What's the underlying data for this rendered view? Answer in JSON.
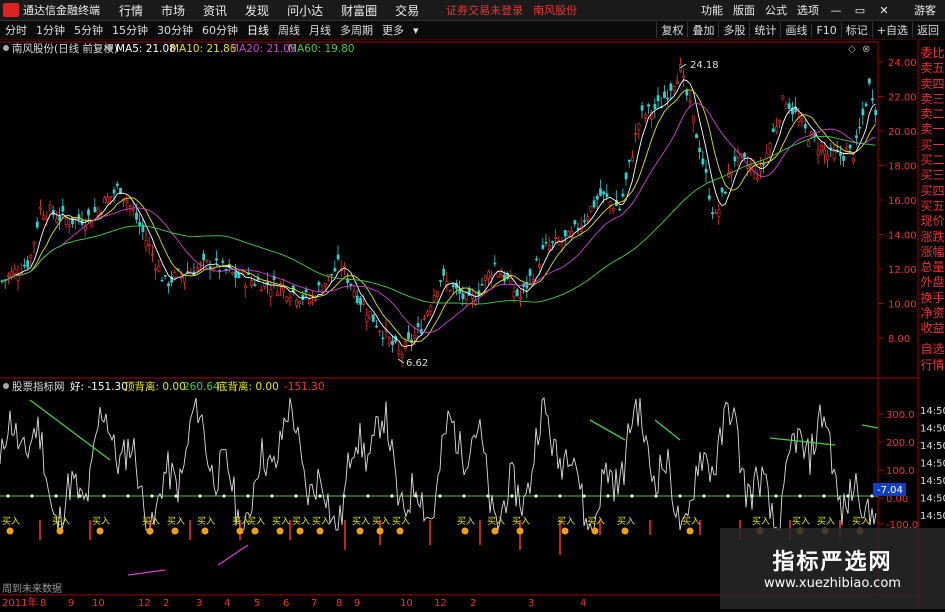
{
  "titlebar": {
    "app_title": "通达信金融终端",
    "menu": [
      "行情",
      "市场",
      "资讯",
      "发现",
      "问小达",
      "财富圈",
      "交易"
    ],
    "warning": "证券交易未登录",
    "stock_name": "南风股份",
    "right": [
      "功能",
      "版面",
      "公式",
      "选项"
    ],
    "guest": "游客"
  },
  "toolbar": {
    "periods": [
      "分时",
      "1分钟",
      "5分钟",
      "15分钟",
      "30分钟",
      "60分钟",
      "日线",
      "周线",
      "月线",
      "多周期",
      "更多"
    ],
    "active_period": "日线",
    "right": [
      "复权",
      "叠加",
      "多股",
      "统计",
      "画线",
      "F10",
      "标记",
      "+自选",
      "返回"
    ]
  },
  "main_chart": {
    "title": "南风股份(日线 前复权)",
    "ma": [
      {
        "label": "MA5: 21.08",
        "color": "#ffffff"
      },
      {
        "label": "MA10: 21.86",
        "color": "#e5e500"
      },
      {
        "label": "MA20: 21.05",
        "color": "#d040d0"
      },
      {
        "label": "MA60: 19.80",
        "color": "#40d040"
      }
    ],
    "high_label": "24.18",
    "low_label": "6.62",
    "y_ticks": [
      "24.00",
      "22.00",
      "20.00",
      "18.00",
      "16.00",
      "14.00",
      "12.00",
      "10.00",
      "8.00"
    ],
    "colors": {
      "up": "#ff3030",
      "down": "#30d0d0",
      "axis": "#a00000"
    }
  },
  "indicator": {
    "title": "股票指标网",
    "values": [
      {
        "label": "好: -151.30",
        "color": "#ffffff"
      },
      {
        "label": "顶背离: 0.00",
        "color": "#e5e500"
      },
      {
        "label": "260.64",
        "color": "#40d040"
      },
      {
        "label": "底背离: 0.00",
        "color": "#e5e500"
      },
      {
        "label": "-151.30",
        "color": "#ff3030"
      }
    ],
    "y_ticks": [
      "300.0",
      "200.0",
      "100.0",
      "0.00",
      "-100.0"
    ],
    "current_value": "-7.04",
    "buy_label": "买入",
    "bottom_note": "周到未来数据"
  },
  "time_axis": [
    "2011年",
    "8",
    "9",
    "10",
    "12",
    "2",
    "3",
    "4",
    "5",
    "6",
    "7",
    "8",
    "9",
    "10",
    "12",
    "2",
    "3",
    "4"
  ],
  "sidebar": [
    "委比",
    "卖五",
    "卖四",
    "卖三",
    "卖二",
    "卖一",
    "买一",
    "买二",
    "买三",
    "买四",
    "买五",
    "现价",
    "涨跌",
    "涨幅",
    "总量",
    "外盘",
    "换手",
    "净资",
    "收益"
  ],
  "sidebar_bottom": [
    "自选",
    "行情"
  ],
  "time_labels": [
    "14:50",
    "14:50",
    "14:50",
    "14:50",
    "14:50",
    "14:50",
    "14:50"
  ],
  "watermark": {
    "title": "指标严选网",
    "url": "www.xuezhibiao.com"
  }
}
